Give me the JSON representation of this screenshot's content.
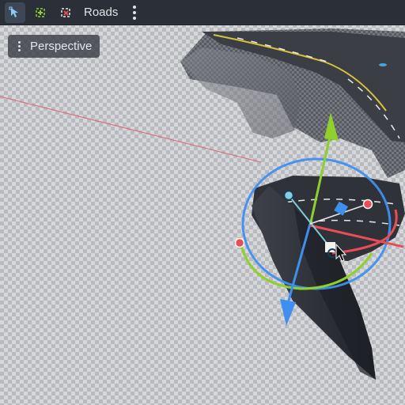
{
  "toolbar": {
    "tools": [
      {
        "icon": "select-node-icon",
        "active": true
      },
      {
        "icon": "add-point-icon",
        "active": false
      },
      {
        "icon": "remove-point-icon",
        "active": false
      }
    ],
    "title": "Roads",
    "menu_icon": "vertical-ellipsis-icon"
  },
  "viewport": {
    "view_menu_label": "Perspective",
    "gizmo_colors": {
      "x_axis": "#e94d55",
      "y_axis": "#8fd02c",
      "z_axis": "#3f8ff0",
      "selection_plane": "#4a90e2"
    },
    "background": "transparent-checkerboard"
  }
}
